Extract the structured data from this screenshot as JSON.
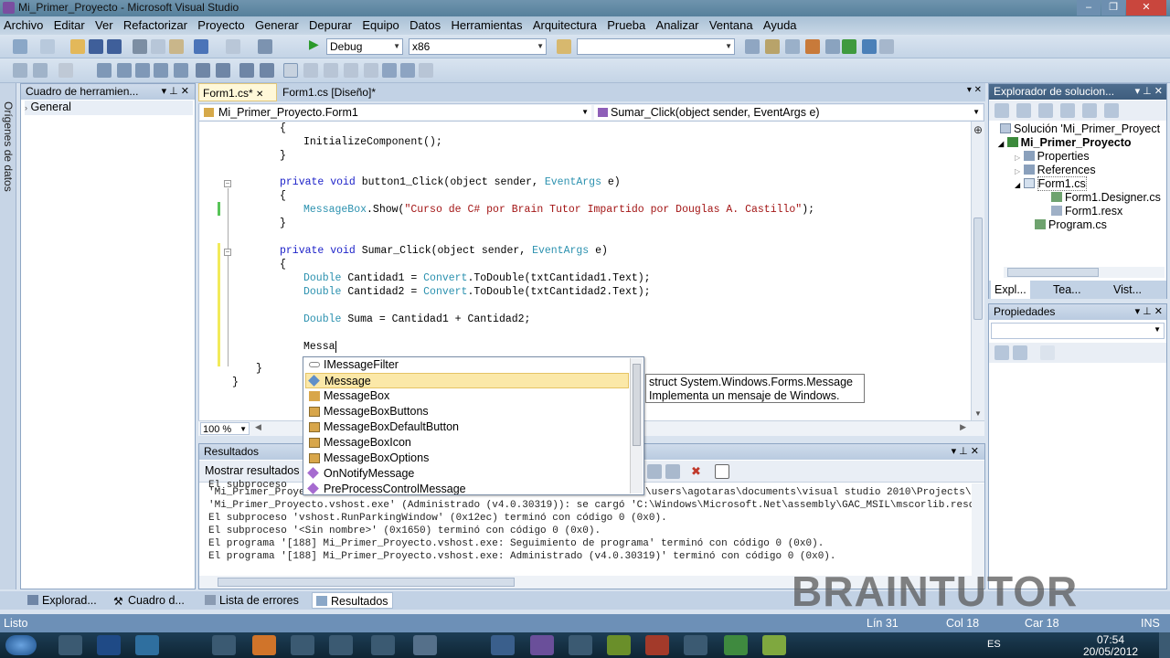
{
  "window": {
    "title": "Mi_Primer_Proyecto - Microsoft Visual Studio"
  },
  "menu": [
    "Archivo",
    "Editar",
    "Ver",
    "Refactorizar",
    "Proyecto",
    "Generar",
    "Depurar",
    "Equipo",
    "Datos",
    "Herramientas",
    "Arquitectura",
    "Prueba",
    "Analizar",
    "Ventana",
    "Ayuda"
  ],
  "toolbar": {
    "config": "Debug",
    "platform": "x86",
    "find": ""
  },
  "side_strip": {
    "label": "Orígenes de datos"
  },
  "toolbox": {
    "title": "Cuadro de herramien...",
    "item": "General"
  },
  "tabs": [
    {
      "label": "Form1.cs*"
    },
    {
      "label": "Form1.cs [Diseño]*"
    }
  ],
  "nav": {
    "class": "Mi_Primer_Proyecto.Form1",
    "member": "Sumar_Click(object sender, EventArgs e)"
  },
  "code": {
    "l1": "{",
    "l2": "InitializeComponent();",
    "l3": "}",
    "l4a": "private void ",
    "l4b": "button1_Click(object sender, ",
    "l4c": "EventArgs",
    "l4d": " e)",
    "l5": "{",
    "l6a": "MessageBox",
    "l6b": ".Show(",
    "l6c": "\"Curso de C# por Brain Tutor Impartido por Douglas A. Castillo\"",
    "l6d": ");",
    "l7": "}",
    "l8a": "private void ",
    "l8b": "Sumar_Click(object sender, ",
    "l8c": "EventArgs",
    "l8d": " e)",
    "l9": "{",
    "l10a": "Double",
    "l10b": " Cantidad1 = ",
    "l10c": "Convert",
    "l10d": ".ToDouble(txtCantidad1.Text);",
    "l11a": "Double",
    "l11b": " Cantidad2 = ",
    "l11c": "Convert",
    "l11d": ".ToDouble(txtCantidad2.Text);",
    "l12a": "Double",
    "l12b": " Suma = Cantidad1 + Cantidad2;",
    "l13": "Messa",
    "l14": "}",
    "l15": "}"
  },
  "zoom": "100 %",
  "autocomplete": [
    {
      "label": "IMessageFilter",
      "icon": "interface-icon"
    },
    {
      "label": "Message",
      "icon": "struct-icon"
    },
    {
      "label": "MessageBox",
      "icon": "class-icon"
    },
    {
      "label": "MessageBoxButtons",
      "icon": "enum-icon"
    },
    {
      "label": "MessageBoxDefaultButton",
      "icon": "enum-icon"
    },
    {
      "label": "MessageBoxIcon",
      "icon": "enum-icon"
    },
    {
      "label": "MessageBoxOptions",
      "icon": "enum-icon"
    },
    {
      "label": "OnNotifyMessage",
      "icon": "method-icon"
    },
    {
      "label": "PreProcessControlMessage",
      "icon": "method-icon"
    }
  ],
  "tooltip": {
    "line1": "struct System.Windows.Forms.Message",
    "line2": "Implementa un mensaje de Windows."
  },
  "output": {
    "title": "Resultados",
    "show_label": "Mostrar resultados",
    "lines": [
      "El subproceso",
      "'Mi_Primer_Proyect",
      "'Mi_Primer_Proyecto.vshost.exe' (Administrado (v4.0.30319)): se cargó 'C:\\Windows\\Microsoft.Net\\assembly\\GAC_MSIL\\mscorlib.reso",
      "El subproceso 'vshost.RunParkingWindow' (0x12ec) terminó con código 0 (0x0).",
      "El subproceso '<Sin nombre>' (0x1650) terminó con código 0 (0x0).",
      "El programa '[188] Mi_Primer_Proyecto.vshost.exe: Seguimiento de programa' terminó con código 0 (0x0).",
      "El programa '[188] Mi_Primer_Proyecto.vshost.exe: Administrado (v4.0.30319)' terminó con código 0 (0x0)."
    ],
    "path_tail": "\\users\\agotaras\\documents\\visual studio 2010\\Projects\\"
  },
  "solution": {
    "title": "Explorador de solucion...",
    "items": [
      "Solución 'Mi_Primer_Proyect",
      "Mi_Primer_Proyecto",
      "Properties",
      "References",
      "Form1.cs",
      "Form1.Designer.cs",
      "Form1.resx",
      "Program.cs"
    ],
    "tabs": [
      "Expl...",
      "Tea...",
      "Vist..."
    ]
  },
  "properties": {
    "title": "Propiedades"
  },
  "bottom_tabs": [
    "Explorad...",
    "Cuadro d...",
    "Lista de errores",
    "Resultados"
  ],
  "status": {
    "text": "Listo",
    "line": "Lín 31",
    "col": "Col 18",
    "car": "Car 18",
    "mode": "INS"
  },
  "taskbar": {
    "lang": "ES",
    "time": "07:54",
    "date": "20/05/2012"
  },
  "watermark": "BRAINTUTOR",
  "colors": {
    "keyword": "#1d22c9",
    "type": "#2b91af",
    "string": "#a31515",
    "selection": "#fbe8a8"
  }
}
